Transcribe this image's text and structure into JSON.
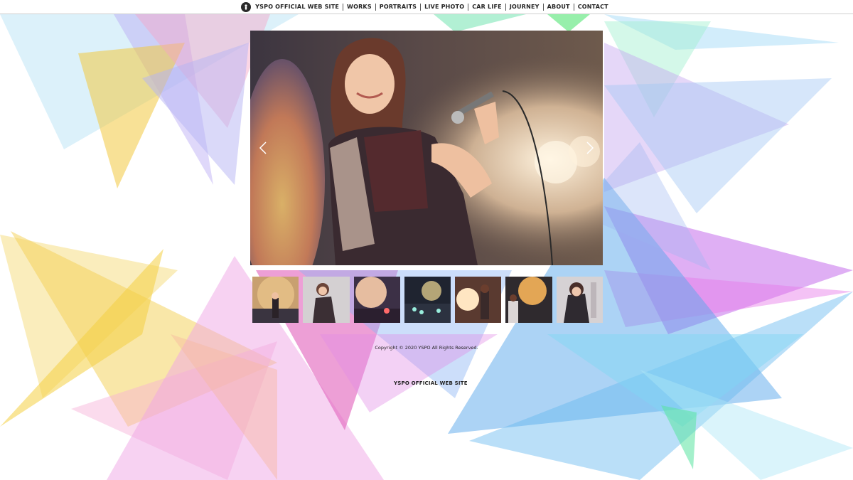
{
  "site": {
    "nav": {
      "items": [
        "YSPO OFFICIAL WEB SITE",
        "WORKS",
        "PORTRAITS",
        "LIVE PHOTO",
        "CAR LIFE",
        "JOURNEY",
        "ABOUT",
        "CONTACT"
      ]
    },
    "footer": {
      "copyright": "Copyright © 2020 YSPO All Rights Reserved.",
      "title": "YSPO OFFICIAL WEB SITE"
    }
  },
  "icons": {
    "logo": "person-silhouette-icon",
    "prev": "chevron-left-icon",
    "next": "chevron-right-icon"
  },
  "colors": {
    "nav_bg": "#ffffff",
    "nav_text": "#222222",
    "accent_pink": "#e85bc8",
    "accent_blue": "#4aa8ee",
    "accent_yellow": "#f5d24a"
  }
}
